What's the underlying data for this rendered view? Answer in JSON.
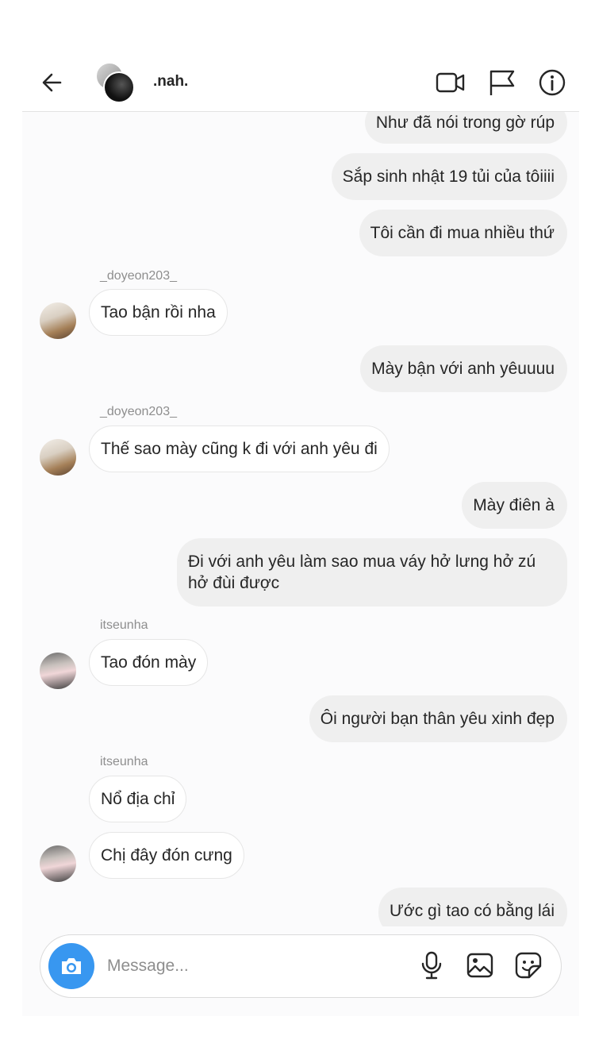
{
  "header": {
    "chat_name": ".nah.",
    "icons": [
      "back-arrow-icon",
      "video-call-icon",
      "flag-icon",
      "info-icon"
    ]
  },
  "messages": [
    {
      "type": "outgoing",
      "text": "Như đã nói trong gờ rúp"
    },
    {
      "type": "outgoing",
      "text": "Sắp sinh nhật 19 tủi của tôiiii"
    },
    {
      "type": "outgoing",
      "text": "Tôi cần đi mua nhiều thứ"
    },
    {
      "type": "incoming",
      "sender": "_doyeon203_",
      "text": "Tao bận rồi nha"
    },
    {
      "type": "outgoing",
      "text": "Mày bận với anh yêuuuu"
    },
    {
      "type": "incoming",
      "sender": "_doyeon203_",
      "text": "Thế sao mày cũng k đi với anh yêu đi"
    },
    {
      "type": "outgoing",
      "text": "Mày điên à"
    },
    {
      "type": "outgoing",
      "text": "Đi với anh yêu làm sao mua váy hở lưng hở zú hở đùi được"
    },
    {
      "type": "incoming",
      "sender": "itseunha",
      "text": "Tao đón mày"
    },
    {
      "type": "outgoing",
      "text": "Ôi người bạn thân yêu xinh đẹp"
    },
    {
      "type": "incoming",
      "sender": "itseunha",
      "text": "Nổ địa chỉ"
    },
    {
      "type": "incoming",
      "text": "Chị đây đón cưng"
    },
    {
      "type": "outgoing",
      "text": "Ước gì tao có bằng lái"
    }
  ],
  "composer": {
    "placeholder": "Message...",
    "accent_color": "#3897f0",
    "icons": [
      "camera-icon",
      "microphone-icon",
      "gallery-icon",
      "sticker-icon"
    ]
  }
}
